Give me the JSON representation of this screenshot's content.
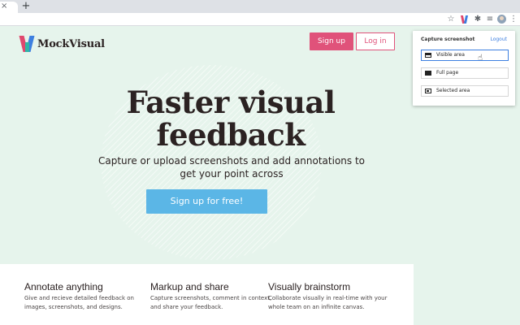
{
  "browser": {
    "tab_close": "×",
    "new_tab": "+",
    "icons": [
      "star-icon",
      "mockvisual-extension-icon",
      "puzzle-icon",
      "queue-icon",
      "profile-avatar",
      "menu-icon"
    ]
  },
  "brand": {
    "name": "MockVisual",
    "colors": {
      "pink": "#e0527a",
      "blue": "#3d7fe0",
      "teal": "#2fb6a6",
      "cta": "#5bb6e6",
      "background": "#e6f4ec"
    }
  },
  "nav": {
    "signup_label": "Sign up",
    "login_label": "Log in"
  },
  "hero": {
    "title": "Faster visual feedback",
    "subtitle": "Capture or upload screenshots and add annotations to get your point across",
    "cta_label": "Sign up for free!"
  },
  "features": [
    {
      "title": "Annotate anything",
      "text": "Give and recieve detailed feedback on images, screenshots, and designs."
    },
    {
      "title": "Markup and share",
      "text": "Capture screenshots, comment in context, and share your feedback."
    },
    {
      "title": "Visually brainstorm",
      "text": "Collaborate visually in real-time with your whole team on an infinite canvas."
    }
  ],
  "popup": {
    "title": "Capture screenshot",
    "logout_label": "Logout",
    "options": [
      {
        "label": "Visible area",
        "icon": "visible-area-icon",
        "active": true
      },
      {
        "label": "Full page",
        "icon": "full-page-icon",
        "active": false
      },
      {
        "label": "Selected area",
        "icon": "selected-area-icon",
        "active": false
      }
    ]
  }
}
